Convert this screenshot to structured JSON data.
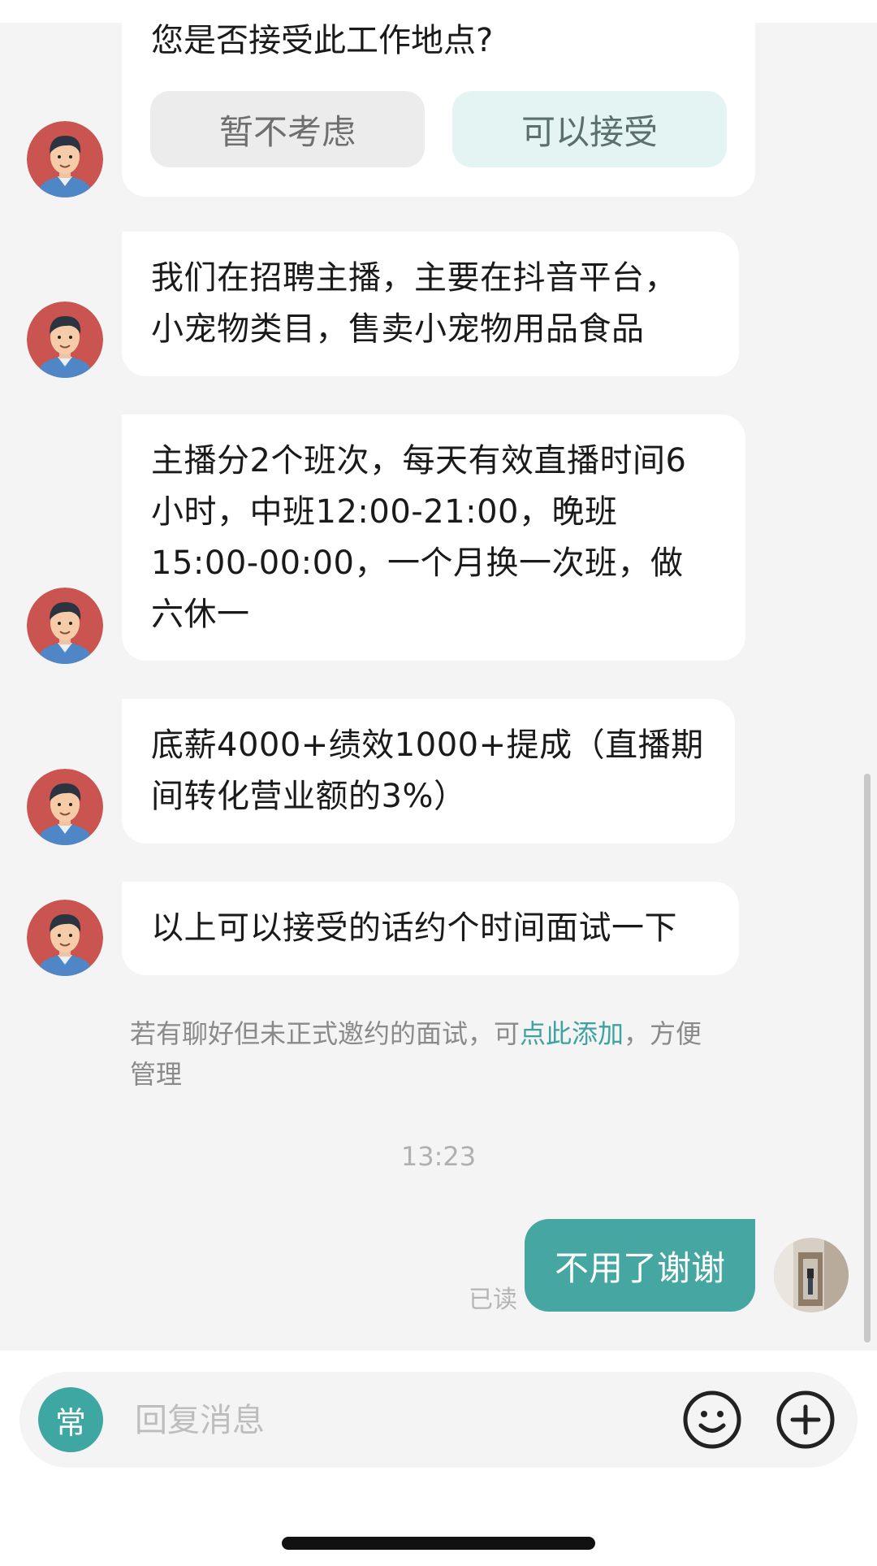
{
  "location_card": {
    "question": "您是否接受此工作地点?",
    "decline_label": "暂不考虑",
    "accept_label": "可以接受"
  },
  "messages": [
    {
      "text": "我们在招聘主播，主要在抖音平台，\n小宠物类目，售卖小宠物用品食品"
    },
    {
      "text": "主播分2个班次，每天有效直播时间6\n小时，中班12:00-21:00，晚班\n15:00-00:00，一个月换一次班，做\n六休一"
    },
    {
      "text": "底薪4000+绩效1000+提成（直播期\n间转化营业额的3%）"
    },
    {
      "text": "以上可以接受的话约个时间面试一下"
    }
  ],
  "hint": {
    "prefix": "若有聊好但未正式邀约的面试，可",
    "link": "点此添加",
    "suffix": "，方便\n管理"
  },
  "timestamp": "13:23",
  "my_message": {
    "text": "不用了谢谢",
    "status": "已读"
  },
  "input_bar": {
    "common_phrases_label": "常",
    "placeholder": "回复消息",
    "emoji_icon": "smiley-face-icon",
    "plus_icon": "plus-circle-icon"
  },
  "colors": {
    "accent": "#46a6a2",
    "link": "#3ea3a0",
    "background": "#f4f4f4",
    "bubble": "#ffffff"
  }
}
